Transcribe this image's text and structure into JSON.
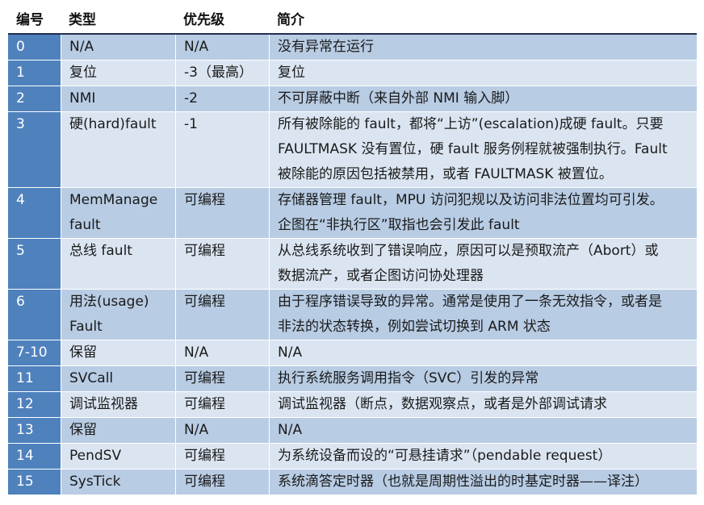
{
  "headers": [
    "编号",
    "类型",
    "优先级",
    "简介"
  ],
  "rows": [
    {
      "num": "0",
      "type": [
        "N/A"
      ],
      "priority": "N/A",
      "desc": [
        "没有异常在运行"
      ]
    },
    {
      "num": "1",
      "type": [
        "复位"
      ],
      "priority": "-3（最高）",
      "desc": [
        "复位"
      ]
    },
    {
      "num": "2",
      "type": [
        "NMI"
      ],
      "priority": "-2",
      "desc": [
        "不可屏蔽中断（来自外部 NMI 输入脚）"
      ]
    },
    {
      "num": "3",
      "type": [
        "硬(hard)fault"
      ],
      "priority": "-1",
      "desc": [
        "所有被除能的 fault，都将“上访”(escalation)成硬 fault。只要",
        "FAULTMASK 没有置位，硬 fault 服务例程就被强制执行。Fault",
        "被除能的原因包括被禁用，或者 FAULTMASK 被置位。"
      ]
    },
    {
      "num": "4",
      "type": [
        "MemManage",
        "fault"
      ],
      "priority": "可编程",
      "desc": [
        "存储器管理 fault，MPU 访问犯规以及访问非法位置均可引发。",
        "企图在“非执行区”取指也会引发此 fault"
      ]
    },
    {
      "num": "5",
      "type": [
        "总线 fault"
      ],
      "priority": "可编程",
      "desc": [
        "从总线系统收到了错误响应，原因可以是预取流产（Abort）或",
        "数据流产，或者企图访问协处理器"
      ]
    },
    {
      "num": "6",
      "type": [
        "用法(usage)",
        "Fault"
      ],
      "priority": "可编程",
      "desc": [
        "由于程序错误导致的异常。通常是使用了一条无效指令，或者是",
        "非法的状态转换，例如尝试切换到 ARM 状态"
      ]
    },
    {
      "num": "7-10",
      "type": [
        "保留"
      ],
      "priority": "N/A",
      "desc": [
        "N/A"
      ]
    },
    {
      "num": "11",
      "type": [
        "SVCall"
      ],
      "priority": "可编程",
      "desc": [
        "执行系统服务调用指令（SVC）引发的异常"
      ]
    },
    {
      "num": "12",
      "type": [
        "调试监视器"
      ],
      "priority": "可编程",
      "desc": [
        "调试监视器（断点，数据观察点，或者是外部调试请求"
      ]
    },
    {
      "num": "13",
      "type": [
        "保留"
      ],
      "priority": "N/A",
      "desc": [
        "N/A"
      ]
    },
    {
      "num": "14",
      "type": [
        "PendSV"
      ],
      "priority": "可编程",
      "desc": [
        "为系统设备而设的“可悬挂请求”（pendable request）"
      ]
    },
    {
      "num": "15",
      "type": [
        "SysTick"
      ],
      "priority": "可编程",
      "desc": [
        "系统滴答定时器（也就是周期性溢出的时基定时器——译注）"
      ]
    }
  ]
}
